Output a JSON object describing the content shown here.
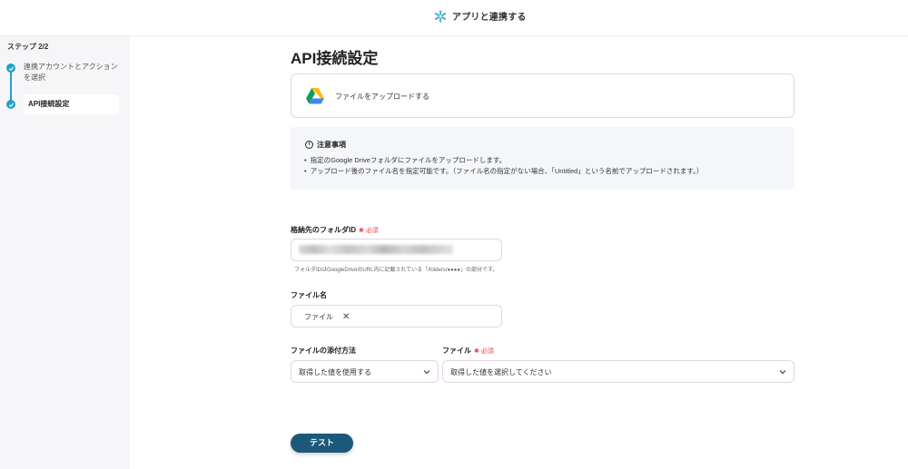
{
  "header": {
    "title": "アプリと連携する",
    "accent": "#23a2c7"
  },
  "sidebar": {
    "step_label": "ステップ 2/2",
    "steps": [
      {
        "label": "連携アカウントとアクションを選択",
        "state": "done"
      },
      {
        "label": "API接続設定",
        "state": "current"
      }
    ]
  },
  "main": {
    "title": "API接続設定",
    "app_card": {
      "icon": "google-drive-icon",
      "action": "ファイルをアップロードする"
    },
    "notice": {
      "title": "注意事項",
      "items": [
        "指定のGoogle Driveフォルダにファイルをアップロードします。",
        "アップロード後のファイル名を指定可能です。（ファイル名の指定がない場合、「Untitled」という名前でアップロードされます。）"
      ]
    },
    "folder_id": {
      "label": "格納先のフォルダID",
      "required": "必須",
      "hint": "フォルダIDはGoogleDriveのURL内に記載されている「/folders/●●●●」の部分です。"
    },
    "file_name": {
      "label": "ファイル名",
      "chip": "ファイル"
    },
    "attach_method": {
      "label": "ファイルの添付方法",
      "value": "取得した値を使用する"
    },
    "file": {
      "label": "ファイル",
      "required": "必須",
      "placeholder": "取得した値を選択してください"
    },
    "test_button": "テスト"
  }
}
